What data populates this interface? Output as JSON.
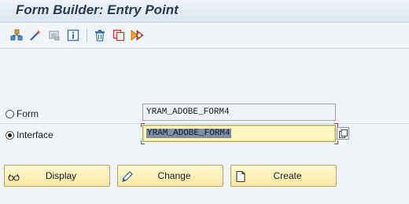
{
  "window": {
    "title": "Form Builder: Entry Point"
  },
  "toolbar": {
    "icons": [
      "object-hierarchy-icon",
      "magic-wand-icon",
      "display-object-icon",
      "info-icon",
      "trash-icon",
      "copy-icon",
      "test-run-icon"
    ]
  },
  "form": {
    "radio_form_label": "Form",
    "radio_interface_label": "Interface",
    "selected": "interface",
    "form_value": "YRAM_ADOBE_FORM4",
    "interface_value": "YRAM_ADOBE_FORM4"
  },
  "buttons": {
    "display_label": "Display",
    "change_label": "Change",
    "create_label": "Create"
  },
  "colors": {
    "button_yellow": "#f6e7a3",
    "active_field": "#fff6c0",
    "selection_blue": "#7d90a6"
  }
}
